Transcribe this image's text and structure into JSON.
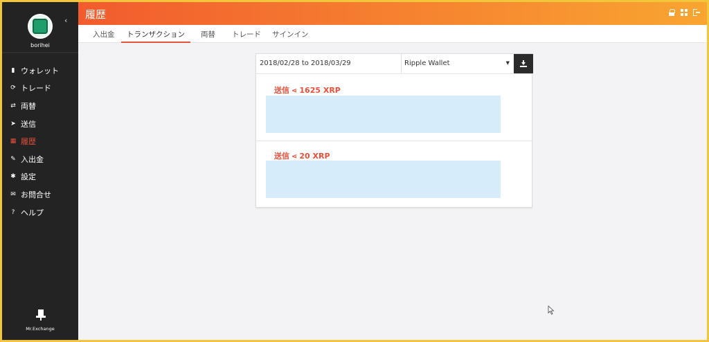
{
  "sidebar": {
    "username": "borihei",
    "collapse_glyph": "‹",
    "items": [
      {
        "label": "ウォレット",
        "icon": "wallet-icon",
        "glyph": "▮"
      },
      {
        "label": "トレード",
        "icon": "refresh-icon",
        "glyph": "⟳"
      },
      {
        "label": "両替",
        "icon": "exchange-icon",
        "glyph": "⇄"
      },
      {
        "label": "送信",
        "icon": "send-icon",
        "glyph": "➤"
      },
      {
        "label": "履歴",
        "icon": "history-icon",
        "glyph": "▦"
      },
      {
        "label": "入出金",
        "icon": "deposit-icon",
        "glyph": "✎"
      },
      {
        "label": "設定",
        "icon": "gear-icon",
        "glyph": "✱"
      },
      {
        "label": "お問合せ",
        "icon": "mail-icon",
        "glyph": "✉"
      },
      {
        "label": "ヘルプ",
        "icon": "help-icon",
        "glyph": "?"
      }
    ],
    "active_index": 4,
    "brand": "Mr.Exchange"
  },
  "header": {
    "title": "履歴",
    "icons": [
      "lock-icon",
      "grid-icon",
      "logout-icon"
    ]
  },
  "tabs": [
    {
      "label": "入出金"
    },
    {
      "label": "トランザクション"
    },
    {
      "label": "両替"
    },
    {
      "label": "トレード"
    },
    {
      "label": "サインイン"
    }
  ],
  "active_tab": 1,
  "filter": {
    "date_range": "2018/02/28 to 2018/03/29",
    "wallet": "Ripple Wallet",
    "download_icon": "download-icon"
  },
  "transactions": [
    {
      "type": "送信",
      "amount": "1625 XRP",
      "details_blurred": true
    },
    {
      "type": "送信",
      "amount": "20 XRP",
      "details_blurred": true
    }
  ],
  "colors": {
    "accent": "#e8503a",
    "header_start": "#f25b2e",
    "header_end": "#f9a531",
    "sidebar_bg": "#232323",
    "detail_bg": "#d6ecfb",
    "frame_border": "#f2c53a"
  }
}
